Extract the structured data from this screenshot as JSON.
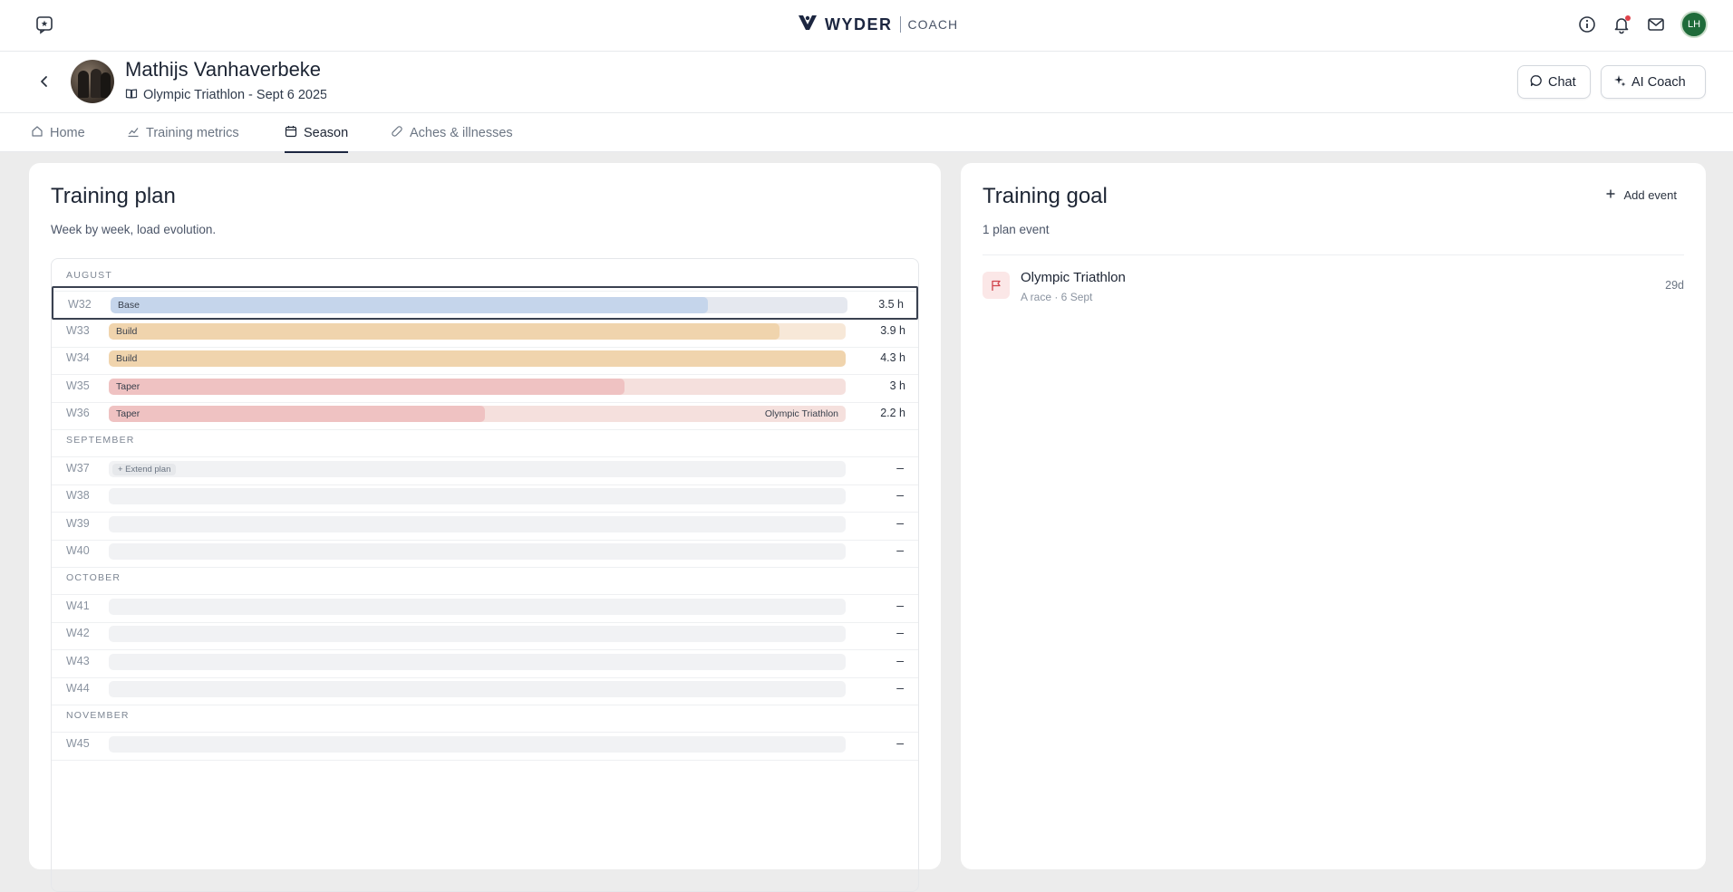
{
  "brand": {
    "name": "WYDER",
    "product": "COACH"
  },
  "user": {
    "initials": "LH"
  },
  "athlete": {
    "name": "Mathijs Vanhaverbeke",
    "event_line": "Olympic Triathlon - Sept 6 2025"
  },
  "actions": {
    "chat_label": "Chat",
    "ai_coach_label": "AI Coach"
  },
  "tabs": [
    {
      "label": "Home",
      "icon": "home-icon"
    },
    {
      "label": "Training metrics",
      "icon": "chart-icon"
    },
    {
      "label": "Season",
      "icon": "calendar-icon",
      "active": true
    },
    {
      "label": "Aches & illnesses",
      "icon": "bandage-icon"
    }
  ],
  "plan": {
    "title": "Training plan",
    "subtitle": "Week by week, load evolution.",
    "months": [
      "AUGUST",
      "SEPTEMBER",
      "OCTOBER",
      "NOVEMBER"
    ],
    "weeks": [
      {
        "week": "W32",
        "phase": "Base",
        "hours": "3.5 h",
        "load_fraction": 0.81,
        "color": "#c5d5eb",
        "track": "#e5e8ef",
        "selected": true
      },
      {
        "week": "W33",
        "phase": "Build",
        "hours": "3.9 h",
        "load_fraction": 0.91,
        "color": "#f0d4ad",
        "track": "#f7e8d8"
      },
      {
        "week": "W34",
        "phase": "Build",
        "hours": "4.3 h",
        "load_fraction": 1.0,
        "color": "#f0d4ad",
        "track": "#f7e8d8"
      },
      {
        "week": "W35",
        "phase": "Taper",
        "hours": "3 h",
        "load_fraction": 0.7,
        "color": "#efc2c2",
        "track": "#f5e0dd"
      },
      {
        "week": "W36",
        "phase": "Taper",
        "hours": "2.2 h",
        "load_fraction": 0.51,
        "color": "#efc2c2",
        "track": "#f5e0dd",
        "event": "Olympic Triathlon"
      },
      {
        "week": "W37",
        "hours": "–",
        "extend": "+ Extend plan"
      },
      {
        "week": "W38",
        "hours": "–"
      },
      {
        "week": "W39",
        "hours": "–"
      },
      {
        "week": "W40",
        "hours": "–"
      },
      {
        "week": "W41",
        "hours": "–"
      },
      {
        "week": "W42",
        "hours": "–"
      },
      {
        "week": "W43",
        "hours": "–"
      },
      {
        "week": "W44",
        "hours": "–"
      },
      {
        "week": "W45",
        "hours": "–"
      }
    ]
  },
  "goal": {
    "title": "Training goal",
    "subtitle": "1 plan event",
    "add_label": "Add event",
    "event_name": "Olympic Triathlon",
    "event_meta": "A race · 6 Sept",
    "event_days": "29d"
  }
}
